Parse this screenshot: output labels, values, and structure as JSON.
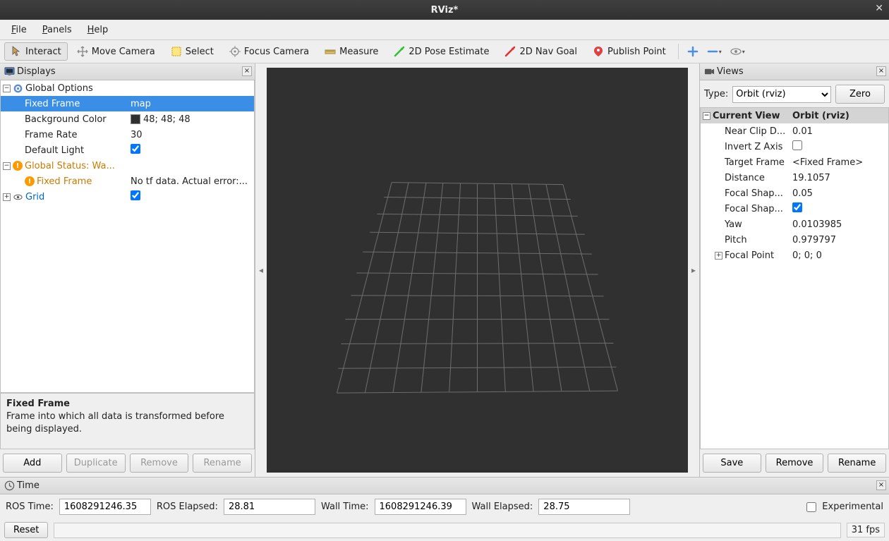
{
  "window": {
    "title": "RViz*"
  },
  "menu": {
    "file": "File",
    "panels": "Panels",
    "help": "Help"
  },
  "toolbar": {
    "interact": "Interact",
    "move_camera": "Move Camera",
    "select": "Select",
    "focus_camera": "Focus Camera",
    "measure": "Measure",
    "pose_estimate": "2D Pose Estimate",
    "nav_goal": "2D Nav Goal",
    "publish_point": "Publish Point"
  },
  "displays_panel": {
    "title": "Displays",
    "tree": {
      "global_options": {
        "label": "Global Options",
        "fixed_frame": {
          "label": "Fixed Frame",
          "value": "map"
        },
        "bg_color": {
          "label": "Background Color",
          "value": "48; 48; 48",
          "color": "#303030"
        },
        "frame_rate": {
          "label": "Frame Rate",
          "value": "30"
        },
        "default_light": {
          "label": "Default Light",
          "checked": true
        }
      },
      "global_status": {
        "label": "Global Status: Wa...",
        "fixed_frame": {
          "label": "Fixed Frame",
          "value": "No tf data.  Actual error:..."
        }
      },
      "grid": {
        "label": "Grid",
        "checked": true
      }
    },
    "help": {
      "title": "Fixed Frame",
      "body": "Frame into which all data is transformed before being displayed."
    },
    "buttons": {
      "add": "Add",
      "duplicate": "Duplicate",
      "remove": "Remove",
      "rename": "Rename"
    }
  },
  "views_panel": {
    "title": "Views",
    "type_label": "Type:",
    "type_value": "Orbit (rviz)",
    "zero": "Zero",
    "header": {
      "name": "Current View",
      "value": "Orbit (rviz)"
    },
    "props": {
      "near_clip": {
        "label": "Near Clip D...",
        "value": "0.01"
      },
      "invert_z": {
        "label": "Invert Z Axis",
        "checked": false
      },
      "target_frame": {
        "label": "Target Frame",
        "value": "<Fixed Frame>"
      },
      "distance": {
        "label": "Distance",
        "value": "19.1057"
      },
      "focal_shape_size": {
        "label": "Focal Shap...",
        "value": "0.05"
      },
      "focal_shape_fixed": {
        "label": "Focal Shap...",
        "checked": true
      },
      "yaw": {
        "label": "Yaw",
        "value": "0.0103985"
      },
      "pitch": {
        "label": "Pitch",
        "value": "0.979797"
      },
      "focal_point": {
        "label": "Focal Point",
        "value": "0; 0; 0"
      }
    },
    "buttons": {
      "save": "Save",
      "remove": "Remove",
      "rename": "Rename"
    }
  },
  "time_panel": {
    "title": "Time",
    "ros_time_label": "ROS Time:",
    "ros_time": "1608291246.35",
    "ros_elapsed_label": "ROS Elapsed:",
    "ros_elapsed": "28.81",
    "wall_time_label": "Wall Time:",
    "wall_time": "1608291246.39",
    "wall_elapsed_label": "Wall Elapsed:",
    "wall_elapsed": "28.75",
    "experimental": "Experimental",
    "reset": "Reset",
    "fps": "31 fps"
  }
}
